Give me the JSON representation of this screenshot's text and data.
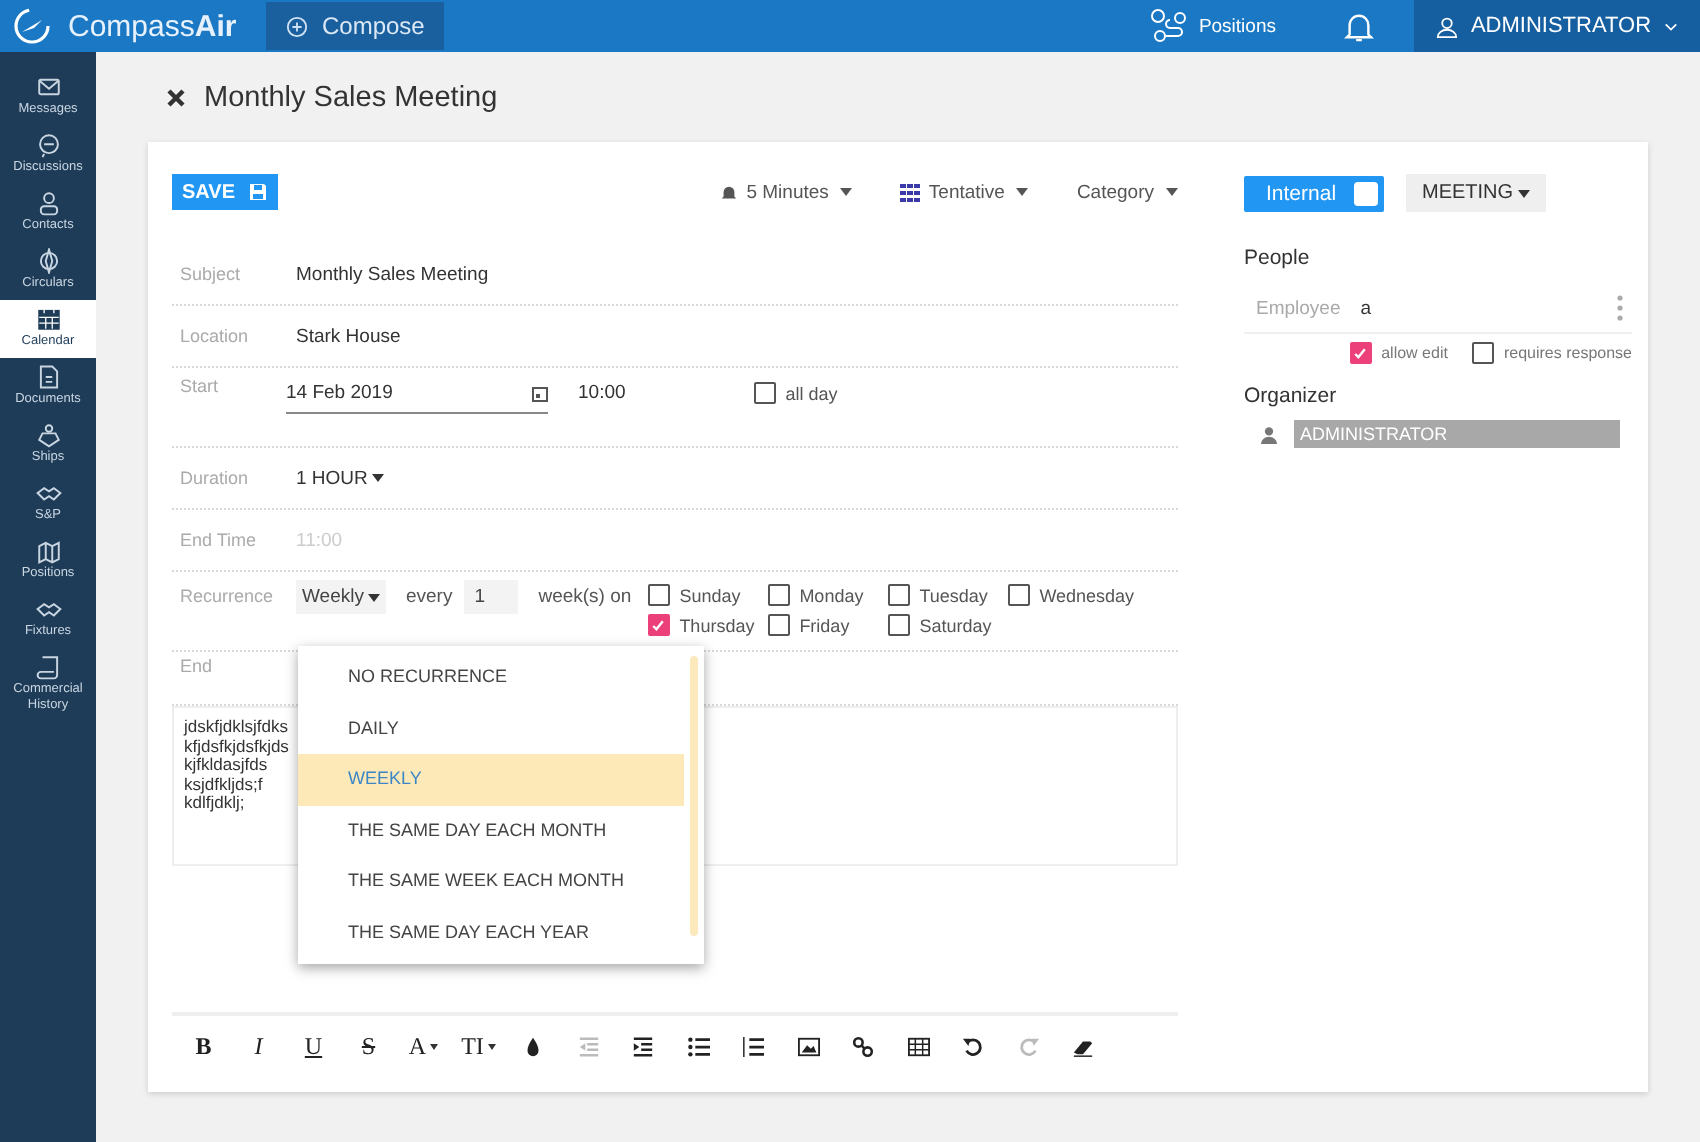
{
  "app": {
    "logo": "Compass**Air**",
    "compose": "Compose",
    "positions": "Positions",
    "user": "ADMINISTRATOR"
  },
  "sidebar": [
    {
      "label": "Messages",
      "selected": false
    },
    {
      "label": "Discussions",
      "selected": false
    },
    {
      "label": "Contacts",
      "selected": false
    },
    {
      "label": "Circulars",
      "selected": false
    },
    {
      "label": "Calendar",
      "selected": true
    },
    {
      "label": "Documents",
      "selected": false
    },
    {
      "label": "Ships",
      "selected": false
    },
    {
      "label": "S&P",
      "selected": false
    },
    {
      "label": "Positions",
      "selected": false
    },
    {
      "label": "Fixtures",
      "selected": false
    },
    {
      "label": "Commercial History",
      "selected": false
    }
  ],
  "title": "Monthly Sales Meeting",
  "toolbar": {
    "save": "SAVE",
    "reminder": "5 Minutes",
    "status": "Tentative",
    "category": "Category",
    "internal": {
      "label": "Internal",
      "on": false
    },
    "type": "MEETING"
  },
  "form": {
    "subject": {
      "label": "Subject",
      "value": "Monthly Sales Meeting"
    },
    "location": {
      "label": "Location",
      "value": "Stark House"
    },
    "start": {
      "label": "Start",
      "date": "14 Feb 2019",
      "time": "10:00",
      "all_day_label": "all day",
      "all_day": false
    },
    "duration": {
      "label": "Duration",
      "value": "1 HOUR"
    },
    "end_time": {
      "label": "End Time",
      "value": "11:00"
    },
    "recurrence": {
      "label": "Recurrence",
      "value": "Weekly",
      "every": "every",
      "count": "1",
      "unit": "week(s) on",
      "days": [
        {
          "label": "Sunday",
          "checked": false
        },
        {
          "label": "Monday",
          "checked": false
        },
        {
          "label": "Tuesday",
          "checked": false
        },
        {
          "label": "Wednesday",
          "checked": false
        },
        {
          "label": "Thursday",
          "checked": true
        },
        {
          "label": "Friday",
          "checked": false
        },
        {
          "label": "Saturday",
          "checked": false
        }
      ],
      "options": [
        {
          "label": "NO RECURRENCE",
          "selected": false
        },
        {
          "label": "DAILY",
          "selected": false
        },
        {
          "label": "WEEKLY",
          "selected": true
        },
        {
          "label": "THE SAME DAY EACH MONTH",
          "selected": false
        },
        {
          "label": "THE SAME WEEK EACH MONTH",
          "selected": false
        },
        {
          "label": "THE SAME DAY EACH YEAR",
          "selected": false
        }
      ]
    },
    "end": {
      "label": "End"
    },
    "notes": [
      "jdskfjdklsjfdks",
      "kfjdsfkjdsfkjds",
      "kjfkldasjfds",
      "ksjdfkljds;f",
      "kdlfjdklj;"
    ]
  },
  "editor_toolbar": [
    {
      "label": "B",
      "disabled": false
    },
    {
      "label": "I",
      "disabled": false
    },
    {
      "label": "U",
      "disabled": false
    },
    {
      "label": "S",
      "disabled": false
    },
    {
      "label": "A",
      "disabled": false
    },
    {
      "label": "TI",
      "disabled": false
    },
    {
      "disabled": false
    },
    {
      "disabled": true
    },
    {
      "disabled": false
    },
    {
      "disabled": false
    },
    {
      "disabled": false
    },
    {
      "disabled": false
    },
    {
      "disabled": false
    },
    {
      "disabled": false
    },
    {
      "disabled": false
    },
    {
      "disabled": true
    },
    {
      "disabled": false
    }
  ],
  "people": {
    "title": "People",
    "employee_label": "Employee",
    "employee_value": "a",
    "allow_edit": {
      "label": "allow edit",
      "checked": true
    },
    "requires_response": {
      "label": "requires response",
      "checked": false
    },
    "organizer_title": "Organizer",
    "organizer": "ADMINISTRATOR"
  }
}
